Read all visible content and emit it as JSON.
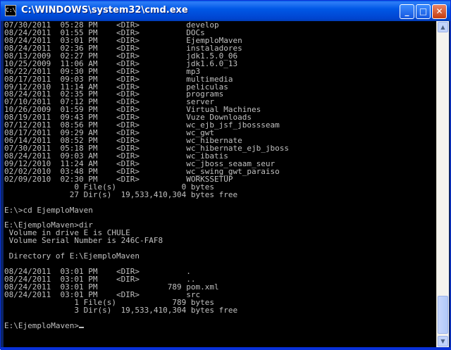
{
  "window": {
    "title": "C:\\WINDOWS\\system32\\cmd.exe",
    "icon_label": "C:\\",
    "buttons": {
      "minimize": "_",
      "maximize": "□",
      "close": "✕"
    }
  },
  "scrollbar": {
    "up": "▲",
    "down": "▼"
  },
  "console": {
    "lines": [
      "07/30/2011  05:28 PM    <DIR>          develop",
      "08/24/2011  01:55 PM    <DIR>          DOCs",
      "08/24/2011  03:01 PM    <DIR>          EjemploMaven",
      "08/24/2011  02:36 PM    <DIR>          instaladores",
      "08/13/2009  02:27 PM    <DIR>          jdk1.5.0_06",
      "10/25/2009  11:06 AM    <DIR>          jdk1.6.0_13",
      "06/22/2011  09:30 PM    <DIR>          mp3",
      "08/17/2011  09:03 PM    <DIR>          multimedia",
      "09/12/2010  11:14 AM    <DIR>          peliculas",
      "08/24/2011  02:35 PM    <DIR>          programs",
      "07/10/2011  07:12 PM    <DIR>          server",
      "10/26/2009  01:59 PM    <DIR>          Virtual Machines",
      "08/19/2011  09:43 PM    <DIR>          Vuze Downloads",
      "07/12/2011  08:56 PM    <DIR>          wc_ejb_jsf_jbossseam",
      "08/17/2011  09:29 AM    <DIR>          wc_gwt",
      "06/14/2011  08:52 PM    <DIR>          wc_hibernate",
      "07/30/2011  05:18 PM    <DIR>          wc_hibernate_ejb_jboss",
      "08/24/2011  09:03 AM    <DIR>          wc_ibatis",
      "09/12/2010  11:24 AM    <DIR>          wc_jboss_seaam_seur",
      "02/02/2010  03:48 PM    <DIR>          wc_swing_gwt_paraiso",
      "02/09/2010  02:30 PM    <DIR>          WORKSSETUP",
      "               0 File(s)              0 bytes",
      "              27 Dir(s)  19,533,410,304 bytes free",
      "",
      "E:\\>cd EjemploMaven",
      "",
      "E:\\EjemploMaven>dir",
      " Volume in drive E is CHULE",
      " Volume Serial Number is 246C-FAF8",
      "",
      " Directory of E:\\EjemploMaven",
      "",
      "08/24/2011  03:01 PM    <DIR>          .",
      "08/24/2011  03:01 PM    <DIR>          ..",
      "08/24/2011  03:01 PM               789 pom.xml",
      "08/24/2011  03:01 PM    <DIR>          src",
      "               1 File(s)            789 bytes",
      "               3 Dir(s)  19,533,410,304 bytes free",
      "",
      "E:\\EjemploMaven>"
    ]
  }
}
